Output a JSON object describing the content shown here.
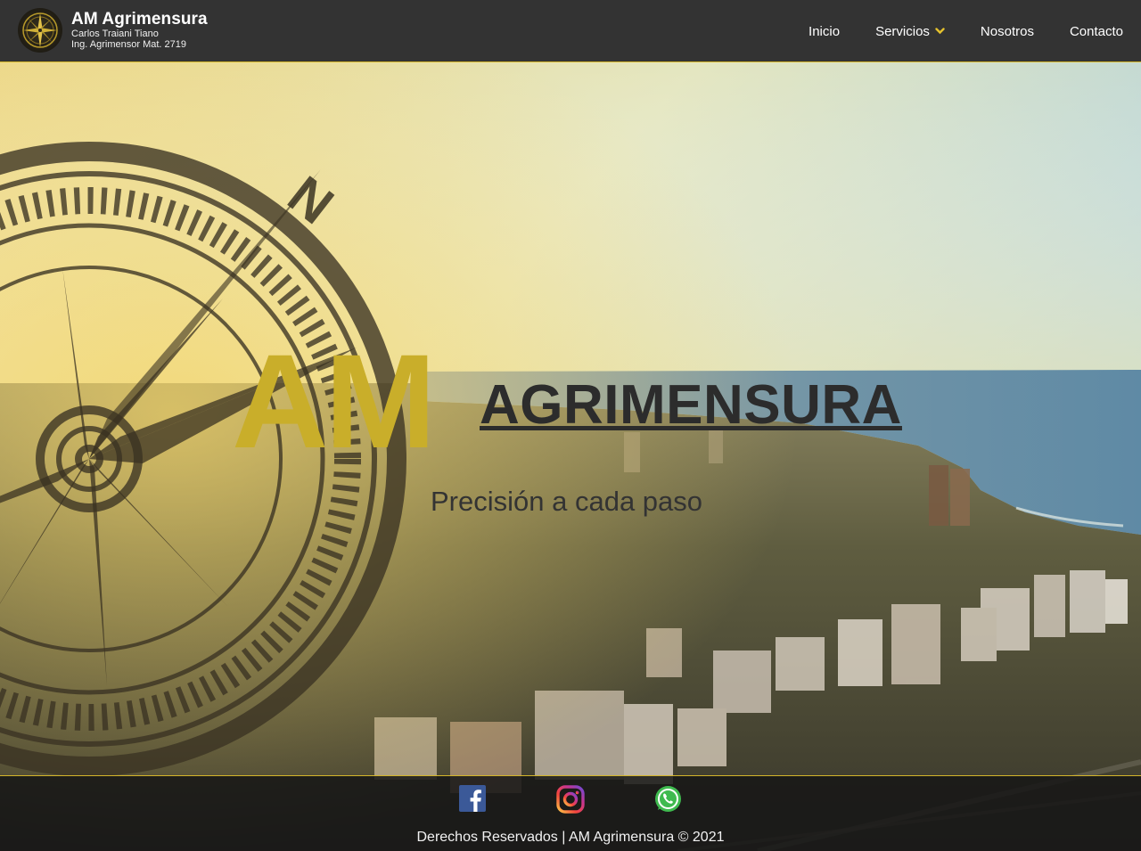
{
  "header": {
    "title": "AM Agrimensura",
    "subtitle1": "Carlos Traiani Tiano",
    "subtitle2": "Ing. Agrimensor Mat. 2719",
    "logo_icon": "compass-rose-icon"
  },
  "nav": {
    "items": [
      {
        "label": "Inicio"
      },
      {
        "label": "Servicios",
        "dropdown": true
      },
      {
        "label": "Nosotros"
      },
      {
        "label": "Contacto"
      }
    ]
  },
  "hero": {
    "am": "AM",
    "brand": "AGRIMENSURA",
    "tagline": "Precisión a cada paso",
    "compass_icon": "compass-icon"
  },
  "footer": {
    "social": [
      {
        "name": "facebook-icon"
      },
      {
        "name": "instagram-icon"
      },
      {
        "name": "whatsapp-icon"
      }
    ],
    "copyright": "Derechos Reservados | AM Agrimensura © 2021"
  },
  "colors": {
    "accent": "#d4b52a",
    "gold_text": "#c9ae2a",
    "header_bg": "#333333",
    "footer_bg": "#161616"
  }
}
